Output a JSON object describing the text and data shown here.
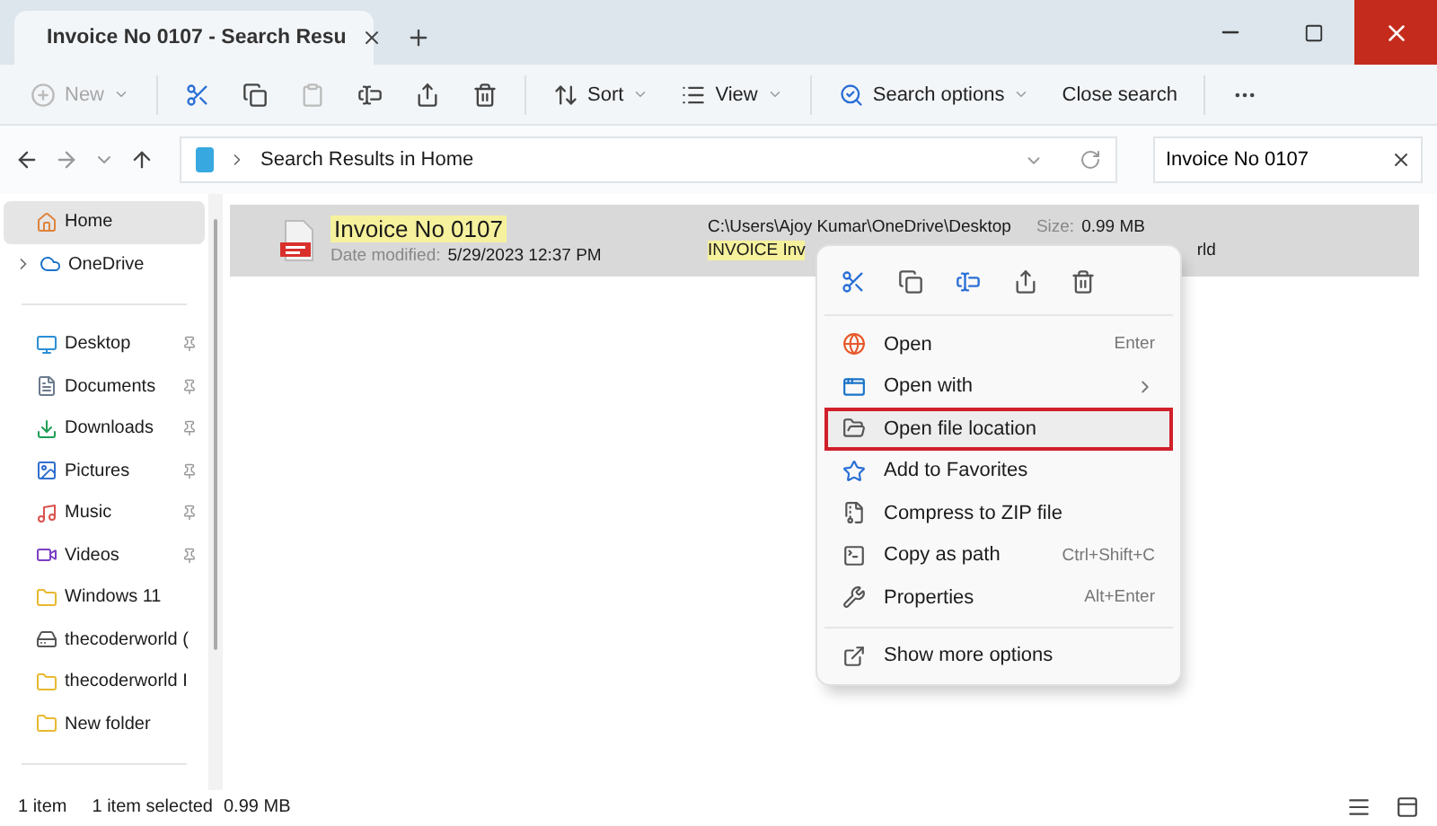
{
  "window": {
    "tab_title": "Invoice No 0107 - Search Resu"
  },
  "toolbar": [
    {
      "kind": "new",
      "label": "New",
      "disabled": true,
      "dropdown": true
    },
    {
      "kind": "separator"
    },
    {
      "kind": "cut",
      "disabled": false
    },
    {
      "kind": "copy",
      "disabled": false
    },
    {
      "kind": "paste",
      "disabled": true
    },
    {
      "kind": "rename",
      "disabled": false
    },
    {
      "kind": "share",
      "disabled": false
    },
    {
      "kind": "delete",
      "disabled": false
    },
    {
      "kind": "separator"
    },
    {
      "kind": "sort",
      "label": "Sort",
      "disabled": false,
      "dropdown": true
    },
    {
      "kind": "view",
      "label": "View",
      "disabled": false,
      "dropdown": true
    },
    {
      "kind": "separator"
    },
    {
      "kind": "searchoptions",
      "label": "Search options",
      "disabled": false,
      "dropdown": true
    },
    {
      "kind": "closesearch",
      "label": "Close search",
      "disabled": false,
      "dropdown": false
    },
    {
      "kind": "separator"
    },
    {
      "kind": "more",
      "disabled": false
    }
  ],
  "address": {
    "path": "Search Results in Home"
  },
  "search": {
    "value": "Invoice No 0107"
  },
  "sidebar": {
    "items": [
      {
        "kind": "home",
        "label": "Home",
        "selected": true,
        "pinned": false,
        "expandable": false
      },
      {
        "kind": "cloud",
        "label": "OneDrive",
        "selected": false,
        "pinned": false,
        "expandable": true
      },
      {
        "kind": "divider"
      },
      {
        "kind": "desktop",
        "label": "Desktop",
        "selected": false,
        "pinned": true,
        "expandable": false
      },
      {
        "kind": "documents",
        "label": "Documents",
        "selected": false,
        "pinned": true,
        "expandable": false
      },
      {
        "kind": "downloads",
        "label": "Downloads",
        "selected": false,
        "pinned": true,
        "expandable": false
      },
      {
        "kind": "pictures",
        "label": "Pictures",
        "selected": false,
        "pinned": true,
        "expandable": false
      },
      {
        "kind": "music",
        "label": "Music",
        "selected": false,
        "pinned": true,
        "expandable": false
      },
      {
        "kind": "videos",
        "label": "Videos",
        "selected": false,
        "pinned": true,
        "expandable": false
      },
      {
        "kind": "folder",
        "label": "Windows 11",
        "selected": false,
        "pinned": false,
        "expandable": false
      },
      {
        "kind": "drive",
        "label": "thecoderworld (",
        "selected": false,
        "pinned": false,
        "expandable": false
      },
      {
        "kind": "folder",
        "label": "thecoderworld I",
        "selected": false,
        "pinned": false,
        "expandable": false
      },
      {
        "kind": "folder",
        "label": "New folder",
        "selected": false,
        "pinned": false,
        "expandable": false
      },
      {
        "kind": "divider"
      }
    ]
  },
  "results": [
    {
      "name": "Invoice No 0107",
      "name_highlighted": true,
      "selected": true,
      "date_label": "Date modified:",
      "date": "5/29/2023 12:37 PM",
      "path": "C:\\Users\\Ajoy Kumar\\OneDrive\\Desktop",
      "size_label": "Size:",
      "size": "0.99 MB",
      "snippet": "INVOICE Inv",
      "snippet_highlighted": true,
      "snippet_tail": "rld"
    }
  ],
  "context_menu": {
    "quick_actions": [
      {
        "kind": "cut"
      },
      {
        "kind": "copy"
      },
      {
        "kind": "rename"
      },
      {
        "kind": "share"
      },
      {
        "kind": "delete"
      }
    ],
    "items": [
      {
        "kind": "open",
        "label": "Open",
        "shortcut": "Enter",
        "submenu": false,
        "highlighted": false
      },
      {
        "kind": "openwith",
        "label": "Open with",
        "submenu": true,
        "highlighted": false
      },
      {
        "kind": "location",
        "label": "Open file location",
        "submenu": false,
        "highlighted": true
      },
      {
        "kind": "favorite",
        "label": "Add to Favorites",
        "submenu": false,
        "highlighted": false
      },
      {
        "kind": "zip",
        "label": "Compress to ZIP file",
        "submenu": false,
        "highlighted": false
      },
      {
        "kind": "copypath",
        "label": "Copy as path",
        "shortcut": "Ctrl+Shift+C",
        "submenu": false,
        "highlighted": false
      },
      {
        "kind": "properties",
        "label": "Properties",
        "shortcut": "Alt+Enter",
        "submenu": false,
        "highlighted": false
      },
      {
        "kind": "separator"
      },
      {
        "kind": "moreoptions",
        "label": "Show more options",
        "submenu": false,
        "highlighted": false
      }
    ]
  },
  "status_bar": {
    "count": "1 item",
    "selection": "1 item selected",
    "size": "0.99 MB"
  }
}
